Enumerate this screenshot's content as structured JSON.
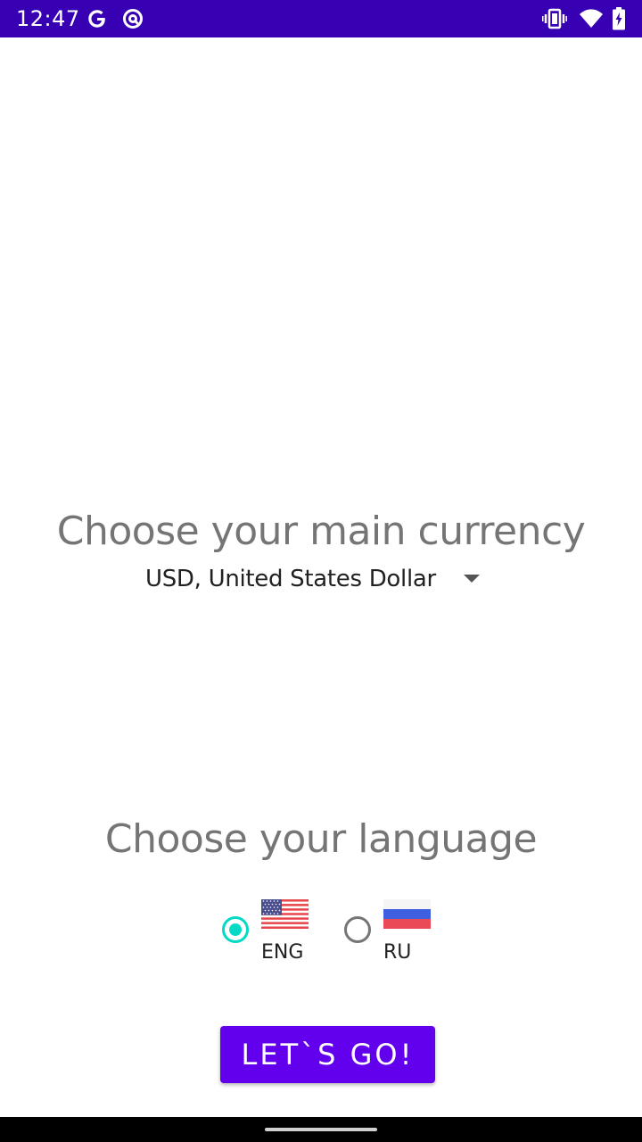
{
  "status_bar": {
    "time": "12:47",
    "background_color": "#3700b3",
    "icons": [
      "google-icon",
      "data-saver-icon",
      "vibrate-icon",
      "wifi-icon",
      "battery-icon"
    ]
  },
  "currency": {
    "title": "Choose your main currency",
    "selected": "USD, United States Dollar"
  },
  "language": {
    "title": "Choose your language",
    "options": [
      {
        "label": "ENG",
        "flag": "us-flag-icon",
        "checked": true
      },
      {
        "label": "RU",
        "flag": "russia-flag-icon",
        "checked": false
      }
    ]
  },
  "action": {
    "go_label": "LET`S GO!"
  },
  "colors": {
    "accent": "#6200ee",
    "radio_checked": "#03dac5",
    "title_text": "#757575"
  }
}
